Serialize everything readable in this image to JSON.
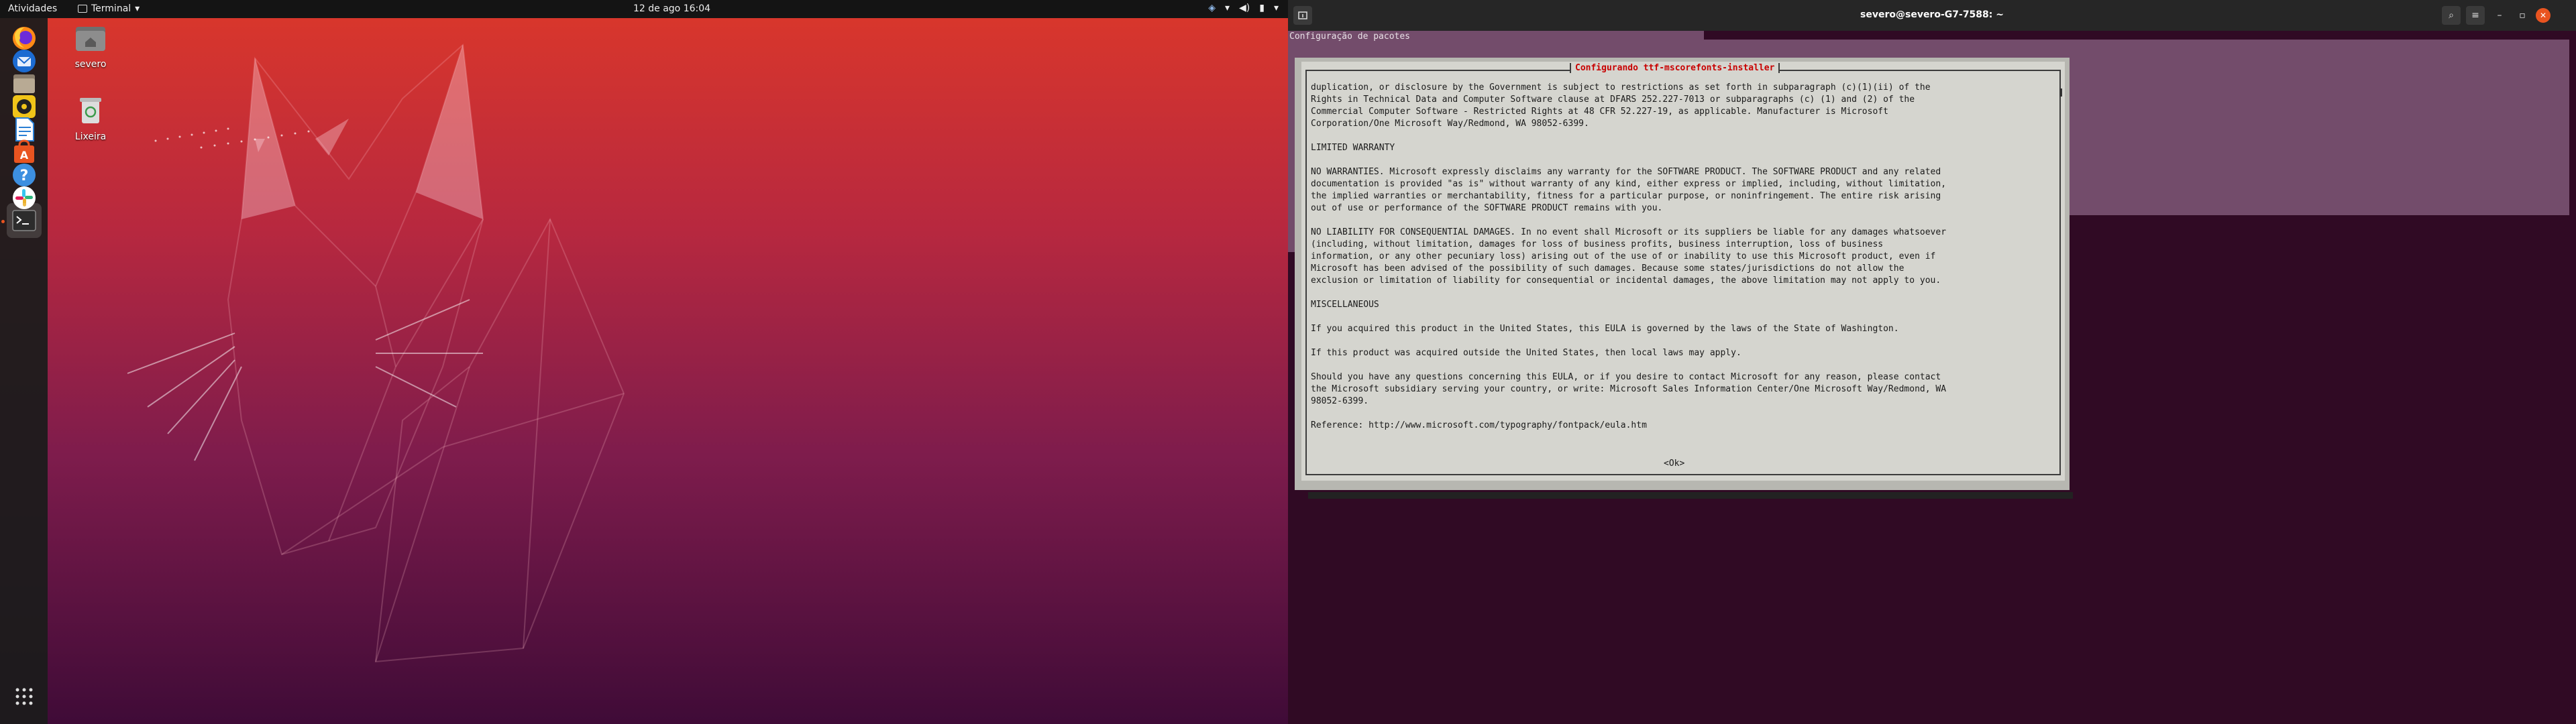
{
  "top_panel": {
    "activities": "Atividades",
    "app_menu": "Terminal",
    "clock": "12 de ago  16:04"
  },
  "desktop_icons": [
    {
      "label": "severo",
      "icon": "home-folder-icon"
    },
    {
      "label": "Lixeira",
      "icon": "trash-icon"
    }
  ],
  "dock": [
    {
      "name": "firefox",
      "icon": "firefox-icon"
    },
    {
      "name": "thunderbird",
      "icon": "thunderbird-icon"
    },
    {
      "name": "files",
      "icon": "files-icon"
    },
    {
      "name": "rhythmbox",
      "icon": "rhythmbox-icon"
    },
    {
      "name": "writer",
      "icon": "libreoffice-writer-icon"
    },
    {
      "name": "software",
      "icon": "software-center-icon"
    },
    {
      "name": "help",
      "icon": "help-icon"
    },
    {
      "name": "slack",
      "icon": "slack-icon"
    },
    {
      "name": "terminal",
      "icon": "terminal-icon"
    }
  ],
  "terminal": {
    "title": "severo@severo-G7-7588: ~",
    "header_text": "Configuração de pacotes",
    "dialog_title": "Configurando ttf-mscorefonts-installer",
    "paragraphs": [
      "duplication, or disclosure by the Government is subject to restrictions as set forth in subparagraph (c)(1)(ii) of the\nRights in Technical Data and Computer Software clause at DFARS 252.227-7013 or subparagraphs (c) (1) and (2) of the\nCommercial Computer Software - Restricted Rights at 48 CFR 52.227-19, as applicable. Manufacturer is Microsoft\nCorporation/One Microsoft Way/Redmond, WA 98052-6399.",
      "LIMITED WARRANTY",
      "NO WARRANTIES. Microsoft expressly disclaims any warranty for the SOFTWARE PRODUCT. The SOFTWARE PRODUCT and any related\ndocumentation is provided \"as is\" without warranty of any kind, either express or implied, including, without limitation,\nthe implied warranties or merchantability, fitness for a particular purpose, or noninfringement. The entire risk arising\nout of use or performance of the SOFTWARE PRODUCT remains with you.",
      "NO LIABILITY FOR CONSEQUENTIAL DAMAGES. In no event shall Microsoft or its suppliers be liable for any damages whatsoever\n(including, without limitation, damages for loss of business profits, business interruption, loss of business\ninformation, or any other pecuniary loss) arising out of the use of or inability to use this Microsoft product, even if\nMicrosoft has been advised of the possibility of such damages. Because some states/jurisdictions do not allow the\nexclusion or limitation of liability for consequential or incidental damages, the above limitation may not apply to you.",
      "MISCELLANEOUS",
      "If you acquired this product in the United States, this EULA is governed by the laws of the State of Washington.",
      "If this product was acquired outside the United States, then local laws may apply.",
      "Should you have any questions concerning this EULA, or if you desire to contact Microsoft for any reason, please contact\nthe Microsoft subsidiary serving your country, or write: Microsoft Sales Information Center/One Microsoft Way/Redmond, WA\n98052-6399.",
      "Reference: http://www.microsoft.com/typography/fontpack/eula.htm"
    ],
    "ok_label": "<Ok>"
  },
  "colors": {
    "dialog_title": "#c80000",
    "accent": "#e95420"
  }
}
